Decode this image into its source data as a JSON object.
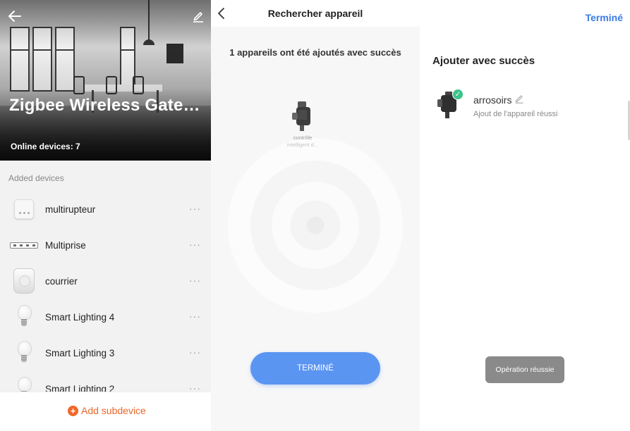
{
  "panel1": {
    "title": "Zigbee Wireless Gatew...",
    "online_devices": "Online devices: 7",
    "added_devices_header": "Added devices",
    "devices": [
      {
        "name": "multirupteur",
        "icon": "switch-icon"
      },
      {
        "name": "Multiprise",
        "icon": "power-strip-icon"
      },
      {
        "name": "courrier",
        "icon": "sensor-icon"
      },
      {
        "name": "Smart Lighting 4",
        "icon": "bulb-icon"
      },
      {
        "name": "Smart Lighting 3",
        "icon": "bulb-icon"
      },
      {
        "name": "Smart Lighting 2",
        "icon": "bulb-icon"
      }
    ],
    "more_glyph": "···",
    "add_label": "Add subdevice",
    "add_plus": "+",
    "accent": "#e8672a"
  },
  "panel2": {
    "title": "Rechercher appareil",
    "message": "1 appareils ont été ajoutés avec succès",
    "device_label_1": "contrôle",
    "device_label_2": "intelligent d...",
    "done_button": "TERMINÉ",
    "accent": "#5b95f2"
  },
  "panel3": {
    "done_link": "Terminé",
    "title": "Ajouter avec succès",
    "device_name": "arrosoirs",
    "device_status": "Ajout de l'appareil réussi",
    "check_glyph": "✓",
    "toast": "Opération réussie",
    "success_color": "#3cc48a"
  }
}
